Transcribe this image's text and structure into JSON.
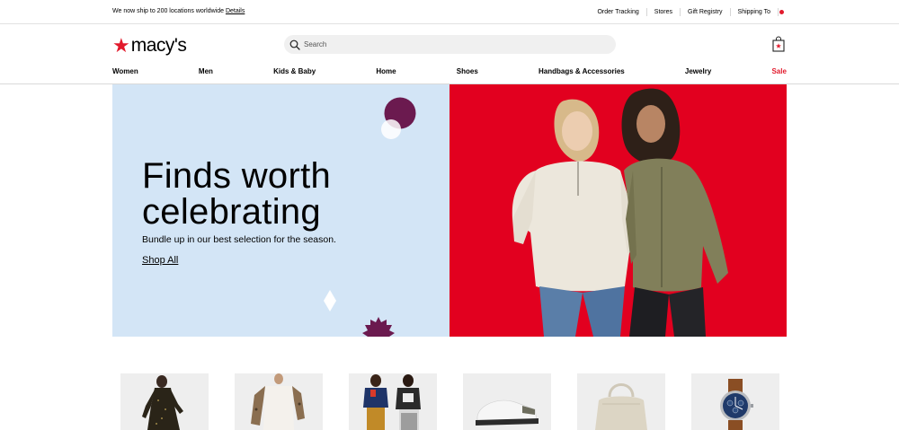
{
  "topbar": {
    "ship_text": "We now ship to 200 locations worldwide",
    "details_link": "Details",
    "links": [
      "Order Tracking",
      "Stores",
      "Gift Registry",
      "Shipping To"
    ]
  },
  "header": {
    "logo_text": "macy's",
    "search_placeholder": "Search"
  },
  "nav": {
    "items": [
      "Women",
      "Men",
      "Kids & Baby",
      "Home",
      "Shoes",
      "Handbags & Accessories",
      "Jewelry",
      "Sale"
    ]
  },
  "hero": {
    "headline_line1": "Finds worth",
    "headline_line2": "celebrating",
    "subtext": "Bundle up in our best selection for the season.",
    "cta": "Shop All"
  },
  "colors": {
    "brand_red": "#e21a2c",
    "hero_blue": "#d3e5f6",
    "hero_red": "#e2001f",
    "accent_plum": "#6b1a4f"
  },
  "products": {
    "tiles": [
      "dress",
      "sweater",
      "kids-outfits",
      "sneakers",
      "handbag",
      "watch"
    ]
  }
}
